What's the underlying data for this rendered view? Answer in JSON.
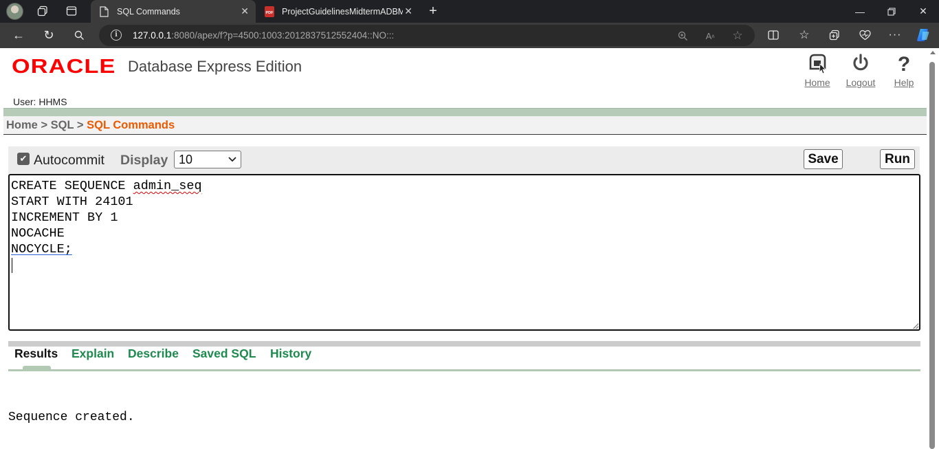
{
  "browser": {
    "tabs": [
      {
        "title": "SQL Commands",
        "active": true
      },
      {
        "title": "ProjectGuidelinesMidtermADBMS",
        "active": false
      }
    ],
    "url": {
      "host": "127.0.0.1",
      "rest": ":8080/apex/f?p=4500:1003:2012837512552404::NO:::"
    }
  },
  "header": {
    "brand": "ORACLE",
    "product": "Database Express Edition",
    "links": [
      {
        "label": "Home",
        "icon": "home-icon"
      },
      {
        "label": "Logout",
        "icon": "power-icon"
      },
      {
        "label": "Help",
        "icon": "help-icon"
      }
    ],
    "user": "User: HHMS"
  },
  "breadcrumb": {
    "home": "Home",
    "sep1": ">",
    "sql": "SQL",
    "sep2": ">",
    "current": "SQL Commands"
  },
  "toolbar": {
    "autocommit_label": "Autocommit",
    "autocommit_checked": true,
    "display_label": "Display",
    "display_value": "10",
    "save_label": "Save",
    "run_label": "Run"
  },
  "editor": {
    "line1_a": "CREATE SEQUENCE ",
    "line1_b": "admin_seq",
    "line2": "START WITH 24101",
    "line3": "INCREMENT BY 1",
    "line4": "NOCACHE",
    "line5": "NOCYCLE;"
  },
  "result_tabs": [
    {
      "label": "Results",
      "active": true
    },
    {
      "label": "Explain",
      "active": false
    },
    {
      "label": "Describe",
      "active": false
    },
    {
      "label": "Saved SQL",
      "active": false
    },
    {
      "label": "History",
      "active": false
    }
  ],
  "result_text": "Sequence created.",
  "colors": {
    "oracle_red": "#ff0000",
    "breadcrumb_current": "#ea5a00",
    "tab_link_green": "#1e8a4e",
    "band_green": "#b7ccb8"
  }
}
